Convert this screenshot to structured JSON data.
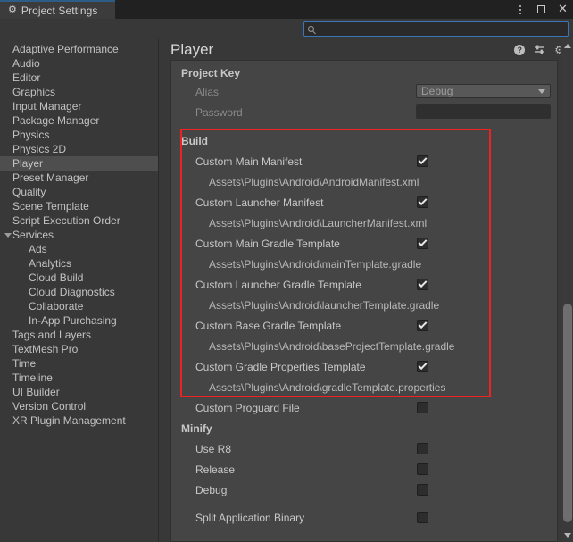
{
  "window": {
    "tab_label": "Project Settings",
    "tab_icon": "gear-icon",
    "controls": {
      "menu": "kebab-menu-icon",
      "maximize": "maximize-icon",
      "close": "close-icon"
    },
    "accent_color": "#2c5d87"
  },
  "search": {
    "value": "",
    "placeholder": "",
    "icon": "search-icon"
  },
  "sidebar": {
    "items": [
      {
        "label": "Adaptive Performance",
        "level": 0,
        "selected": false,
        "expandable": false
      },
      {
        "label": "Audio",
        "level": 0,
        "selected": false,
        "expandable": false
      },
      {
        "label": "Editor",
        "level": 0,
        "selected": false,
        "expandable": false
      },
      {
        "label": "Graphics",
        "level": 0,
        "selected": false,
        "expandable": false
      },
      {
        "label": "Input Manager",
        "level": 0,
        "selected": false,
        "expandable": false
      },
      {
        "label": "Package Manager",
        "level": 0,
        "selected": false,
        "expandable": false
      },
      {
        "label": "Physics",
        "level": 0,
        "selected": false,
        "expandable": false
      },
      {
        "label": "Physics 2D",
        "level": 0,
        "selected": false,
        "expandable": false
      },
      {
        "label": "Player",
        "level": 0,
        "selected": true,
        "expandable": false
      },
      {
        "label": "Preset Manager",
        "level": 0,
        "selected": false,
        "expandable": false
      },
      {
        "label": "Quality",
        "level": 0,
        "selected": false,
        "expandable": false
      },
      {
        "label": "Scene Template",
        "level": 0,
        "selected": false,
        "expandable": false
      },
      {
        "label": "Script Execution Order",
        "level": 0,
        "selected": false,
        "expandable": false
      },
      {
        "label": "Services",
        "level": 0,
        "selected": false,
        "expandable": true
      },
      {
        "label": "Ads",
        "level": 1,
        "selected": false,
        "expandable": false
      },
      {
        "label": "Analytics",
        "level": 1,
        "selected": false,
        "expandable": false
      },
      {
        "label": "Cloud Build",
        "level": 1,
        "selected": false,
        "expandable": false
      },
      {
        "label": "Cloud Diagnostics",
        "level": 1,
        "selected": false,
        "expandable": false
      },
      {
        "label": "Collaborate",
        "level": 1,
        "selected": false,
        "expandable": false
      },
      {
        "label": "In-App Purchasing",
        "level": 1,
        "selected": false,
        "expandable": false
      },
      {
        "label": "Tags and Layers",
        "level": 0,
        "selected": false,
        "expandable": false
      },
      {
        "label": "TextMesh Pro",
        "level": 0,
        "selected": false,
        "expandable": false
      },
      {
        "label": "Time",
        "level": 0,
        "selected": false,
        "expandable": false
      },
      {
        "label": "Timeline",
        "level": 0,
        "selected": false,
        "expandable": false
      },
      {
        "label": "UI Builder",
        "level": 0,
        "selected": false,
        "expandable": false
      },
      {
        "label": "Version Control",
        "level": 0,
        "selected": false,
        "expandable": false
      },
      {
        "label": "XR Plugin Management",
        "level": 0,
        "selected": false,
        "expandable": false
      }
    ]
  },
  "main": {
    "title": "Player",
    "header_icons": [
      {
        "name": "help-icon",
        "glyph": "?"
      },
      {
        "name": "preset-icon",
        "glyph": ""
      },
      {
        "name": "gear-icon",
        "glyph": "⚙"
      }
    ],
    "project_key": {
      "heading": "Project Key",
      "alias_label": "Alias",
      "alias_value": "Debug",
      "password_label": "Password",
      "password_value": ""
    },
    "build": {
      "heading": "Build",
      "rows": [
        {
          "label": "Custom Main Manifest",
          "checked": true,
          "path": "Assets\\Plugins\\Android\\AndroidManifest.xml"
        },
        {
          "label": "Custom Launcher Manifest",
          "checked": true,
          "path": "Assets\\Plugins\\Android\\LauncherManifest.xml"
        },
        {
          "label": "Custom Main Gradle Template",
          "checked": true,
          "path": "Assets\\Plugins\\Android\\mainTemplate.gradle"
        },
        {
          "label": "Custom Launcher Gradle Template",
          "checked": true,
          "path": "Assets\\Plugins\\Android\\launcherTemplate.gradle"
        },
        {
          "label": "Custom Base Gradle Template",
          "checked": true,
          "path": "Assets\\Plugins\\Android\\baseProjectTemplate.gradle"
        },
        {
          "label": "Custom Gradle Properties Template",
          "checked": true,
          "path": "Assets\\Plugins\\Android\\gradleTemplate.properties"
        }
      ],
      "proguard": {
        "label": "Custom Proguard File",
        "checked": false
      }
    },
    "minify": {
      "heading": "Minify",
      "rows": [
        {
          "label": "Use R8",
          "checked": false
        },
        {
          "label": "Release",
          "checked": false
        },
        {
          "label": "Debug",
          "checked": false
        }
      ]
    },
    "split_binary": {
      "label": "Split Application Binary",
      "checked": false
    },
    "annotation_color": "#ee2222"
  }
}
